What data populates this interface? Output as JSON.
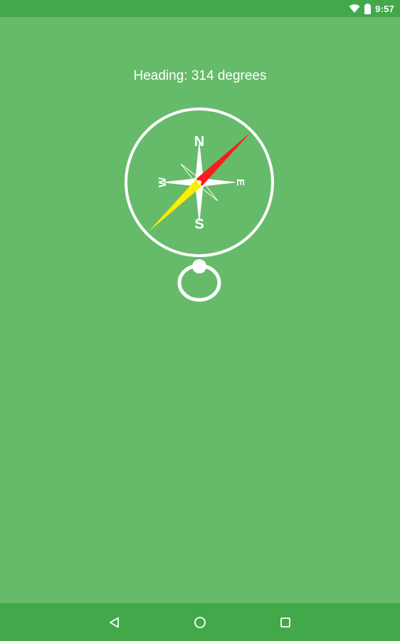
{
  "status_bar": {
    "time": "9:57",
    "icons": [
      "wifi-icon",
      "battery-icon"
    ]
  },
  "compass_screen": {
    "heading_text": "Heading: 314 degrees",
    "cardinal": {
      "north": "N",
      "south": "S",
      "east": "E",
      "west": "W"
    },
    "needle_colors": {
      "north": "#ff1a1a",
      "south": "#ffee00"
    },
    "background_color": "#66bb6a"
  },
  "nav_bar": {
    "buttons": [
      "back-icon",
      "home-icon",
      "recents-icon"
    ]
  }
}
